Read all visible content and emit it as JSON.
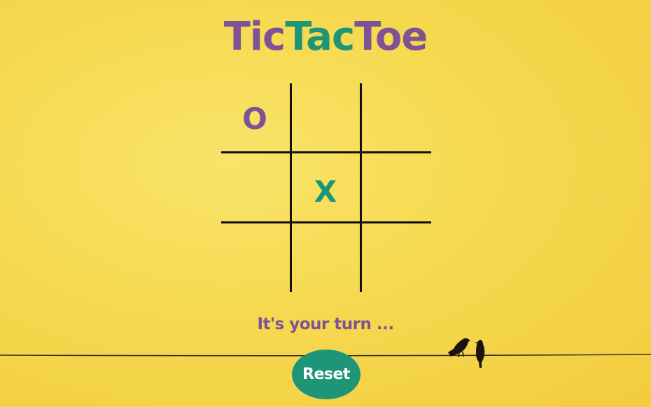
{
  "title": {
    "part1": "Tic",
    "part2": "Tac",
    "part3": "Toe"
  },
  "board": {
    "cells": [
      "O",
      "",
      "",
      "",
      "X",
      "",
      "",
      "",
      ""
    ]
  },
  "status": "It's your turn ...",
  "reset_label": "Reset",
  "colors": {
    "purple": "#7e5395",
    "teal": "#1f9578",
    "background": "#f6d94f",
    "lines": "#111111",
    "reset_bg": "#1f9578"
  },
  "icons": {
    "birds": "birds-on-wire-icon"
  }
}
